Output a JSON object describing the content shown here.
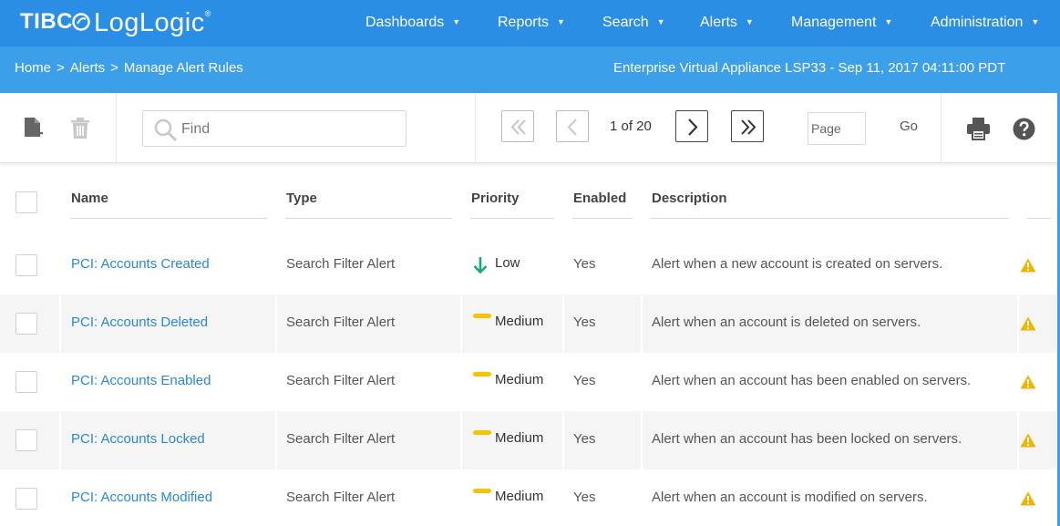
{
  "app": {
    "logo_brand": "TIBC",
    "logo_product": "LogLogic",
    "logo_reg": "®"
  },
  "nav": {
    "items": [
      {
        "label": "Dashboards"
      },
      {
        "label": "Reports"
      },
      {
        "label": "Search"
      },
      {
        "label": "Alerts"
      },
      {
        "label": "Management"
      },
      {
        "label": "Administration"
      }
    ]
  },
  "breadcrumb": {
    "items": [
      "Home",
      "Alerts",
      "Manage Alert Rules"
    ],
    "separator": ">",
    "appliance_info": "Enterprise Virtual Appliance LSP33 - Sep 11, 2017 04:11:00 PDT"
  },
  "toolbar": {
    "search_placeholder": "Find",
    "pagination": "1 of 20",
    "page_placeholder": "Page",
    "go_label": "Go"
  },
  "table": {
    "columns": [
      "Name",
      "Type",
      "Priority",
      "Enabled",
      "Description"
    ],
    "rows": [
      {
        "name": "PCI: Accounts Created",
        "type": "Search Filter Alert",
        "priority": "Low",
        "priority_icon": "arrow-down-icon",
        "enabled": "Yes",
        "description": "Alert when a new account is created on servers."
      },
      {
        "name": "PCI: Accounts Deleted",
        "type": "Search Filter Alert",
        "priority": "Medium",
        "priority_icon": "dash-icon",
        "enabled": "Yes",
        "description": "Alert when an account is deleted on servers."
      },
      {
        "name": "PCI: Accounts Enabled",
        "type": "Search Filter Alert",
        "priority": "Medium",
        "priority_icon": "dash-icon",
        "enabled": "Yes",
        "description": "Alert when an account has been enabled on servers."
      },
      {
        "name": "PCI: Accounts Locked",
        "type": "Search Filter Alert",
        "priority": "Medium",
        "priority_icon": "dash-icon",
        "enabled": "Yes",
        "description": "Alert when an account has been locked on servers."
      },
      {
        "name": "PCI: Accounts Modified",
        "type": "Search Filter Alert",
        "priority": "Medium",
        "priority_icon": "dash-icon",
        "enabled": "Yes",
        "description": "Alert when an account is modified on servers."
      }
    ]
  },
  "colors": {
    "nav_bg": "#2a8ee4",
    "crumb_bg": "#3b9fea",
    "link": "#2a87d8",
    "low_priority": "#1aaa77",
    "medium_priority": "#f5c400",
    "warning": "#f0b400"
  }
}
